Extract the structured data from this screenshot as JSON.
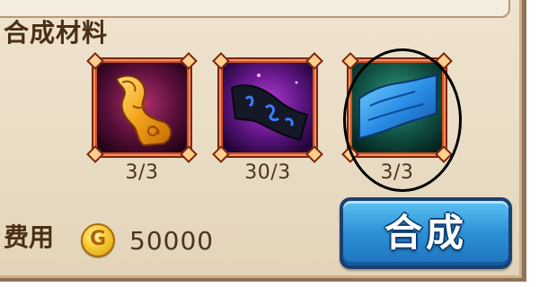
{
  "section": {
    "title": "合成材料"
  },
  "materials": [
    {
      "icon": "golden-scroll-icon",
      "count": "3/3"
    },
    {
      "icon": "dark-rune-cloth-icon",
      "count": "30/3"
    },
    {
      "icon": "blue-cloth-icon",
      "count": "3/3"
    }
  ],
  "cost": {
    "label": "费用",
    "coin_glyph": "G",
    "value": "50000"
  },
  "button": {
    "label": "合成"
  },
  "colors": {
    "panel_bg": "#e9dcc4",
    "slot_frame": "#d5511c",
    "button_blue": "#2d90d6",
    "text_brown": "#4a2f16",
    "coin_gold": "#f7c934"
  }
}
